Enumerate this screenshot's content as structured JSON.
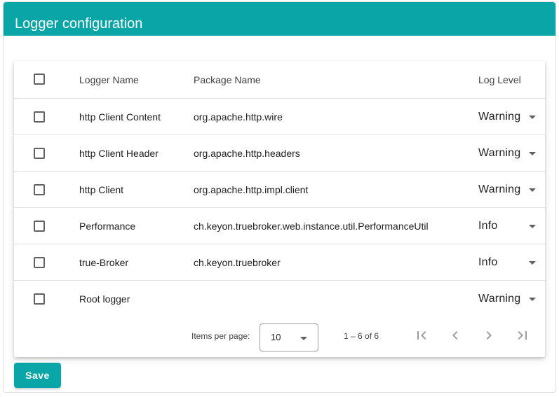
{
  "header": {
    "title": "Logger configuration"
  },
  "table": {
    "columns": {
      "name": "Logger Name",
      "package": "Package Name",
      "level": "Log Level"
    },
    "rows": [
      {
        "name": "http Client Content",
        "package": "org.apache.http.wire",
        "level": "Warning"
      },
      {
        "name": "http Client Header",
        "package": "org.apache.http.headers",
        "level": "Warning"
      },
      {
        "name": "http Client",
        "package": "org.apache.http.impl.client",
        "level": "Warning"
      },
      {
        "name": "Performance",
        "package": "ch.keyon.truebroker.web.instance.util.PerformanceUtil",
        "level": "Info"
      },
      {
        "name": "true-Broker",
        "package": "ch.keyon.truebroker",
        "level": "Info"
      },
      {
        "name": "Root logger",
        "package": "",
        "level": "Warning"
      }
    ]
  },
  "paginator": {
    "items_per_page_label": "Items per page:",
    "items_per_page_value": "10",
    "range_label": "1 – 6 of 6"
  },
  "actions": {
    "save_label": "Save"
  },
  "colors": {
    "accent": "#0aa5a7"
  }
}
